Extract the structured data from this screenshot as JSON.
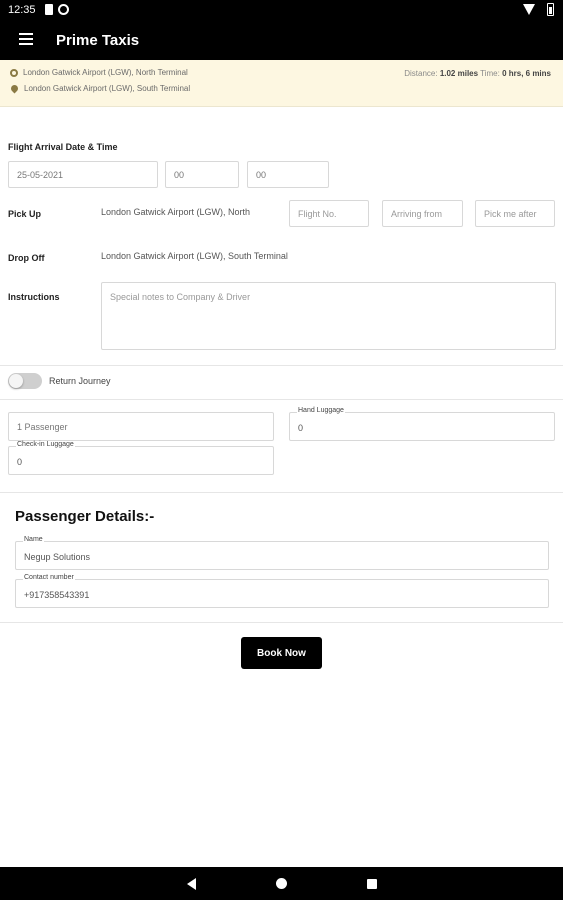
{
  "status_bar": {
    "time": "12:35"
  },
  "app_bar": {
    "title": "Prime Taxis"
  },
  "route": {
    "pickup": "London Gatwick Airport (LGW), North Terminal",
    "dropoff": "London Gatwick Airport (LGW), South Terminal",
    "distance_label": "Distance:",
    "distance_value": "1.02 miles",
    "time_label": "Time:",
    "time_value": "0 hrs, 6 mins"
  },
  "form": {
    "flight_arrival_label": "Flight Arrival Date & Time",
    "date_value": "25-05-2021",
    "hour_value": "00",
    "minute_value": "00",
    "pickup_label": "Pick Up",
    "pickup_value": "London Gatwick Airport (LGW), North",
    "flight_no_placeholder": "Flight No.",
    "arriving_from_placeholder": "Arriving from",
    "pick_me_after_placeholder": "Pick me after",
    "dropoff_label": "Drop Off",
    "dropoff_value": "London Gatwick Airport (LGW), South Terminal",
    "instructions_label": "Instructions",
    "instructions_placeholder": "Special notes to Company & Driver",
    "return_journey_label": "Return Journey",
    "passengers_value": "1 Passenger",
    "hand_luggage_label": "Hand Luggage",
    "hand_luggage_value": "0",
    "checkin_luggage_label": "Check-in Luggage",
    "checkin_luggage_value": "0"
  },
  "passenger_details": {
    "title": "Passenger Details:-",
    "name_label": "Name",
    "name_value": "Negup Solutions",
    "contact_label": "Contact number",
    "contact_value": "+917358543391"
  },
  "book_button": "Book Now",
  "colors": {
    "app_bar": "#000000",
    "route_bg": "#fdf7e1",
    "pin": "#8a7a44",
    "button": "#000000"
  }
}
